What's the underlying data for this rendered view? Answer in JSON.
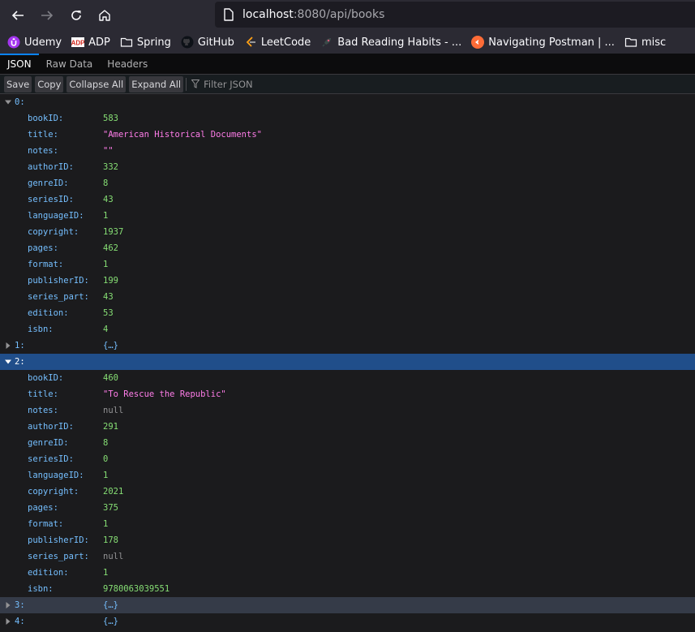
{
  "browser": {
    "url_host": "localhost",
    "url_rest": ":8080/api/books",
    "bookmarks": [
      {
        "label": "Udemy",
        "icon": "udemy-icon"
      },
      {
        "label": "ADP",
        "icon": "adp-icon"
      },
      {
        "label": "Spring",
        "icon": "folder-icon"
      },
      {
        "label": "GitHub",
        "icon": "github-icon"
      },
      {
        "label": "LeetCode",
        "icon": "leetcode-icon"
      },
      {
        "label": "Bad Reading Habits - ...",
        "icon": "rocket-icon"
      },
      {
        "label": "Navigating Postman | ...",
        "icon": "postman-icon"
      },
      {
        "label": "misc",
        "icon": "folder-icon"
      }
    ]
  },
  "viewer": {
    "tabs": [
      "JSON",
      "Raw Data",
      "Headers"
    ],
    "active_tab": "JSON",
    "toolbar": {
      "save": "Save",
      "copy": "Copy",
      "collapse_all": "Collapse All",
      "expand_all": "Expand All",
      "filter_placeholder": "Filter JSON"
    }
  },
  "tree": {
    "items": [
      {
        "index": "0:",
        "expanded": true,
        "fields": [
          {
            "key": "bookID:",
            "value": "583",
            "type": "num"
          },
          {
            "key": "title:",
            "value": "\"American Historical Documents\"",
            "type": "str"
          },
          {
            "key": "notes:",
            "value": "\"\"",
            "type": "str"
          },
          {
            "key": "authorID:",
            "value": "332",
            "type": "num"
          },
          {
            "key": "genreID:",
            "value": "8",
            "type": "num"
          },
          {
            "key": "seriesID:",
            "value": "43",
            "type": "num"
          },
          {
            "key": "languageID:",
            "value": "1",
            "type": "num"
          },
          {
            "key": "copyright:",
            "value": "1937",
            "type": "num"
          },
          {
            "key": "pages:",
            "value": "462",
            "type": "num"
          },
          {
            "key": "format:",
            "value": "1",
            "type": "num"
          },
          {
            "key": "publisherID:",
            "value": "199",
            "type": "num"
          },
          {
            "key": "series_part:",
            "value": "43",
            "type": "num"
          },
          {
            "key": "edition:",
            "value": "53",
            "type": "num"
          },
          {
            "key": "isbn:",
            "value": "4",
            "type": "num"
          }
        ]
      },
      {
        "index": "1:",
        "expanded": false,
        "collapsed_label": "{…}"
      },
      {
        "index": "2:",
        "expanded": true,
        "selected": true,
        "fields": [
          {
            "key": "bookID:",
            "value": "460",
            "type": "num"
          },
          {
            "key": "title:",
            "value": "\"To Rescue the Republic\"",
            "type": "str"
          },
          {
            "key": "notes:",
            "value": "null",
            "type": "null"
          },
          {
            "key": "authorID:",
            "value": "291",
            "type": "num"
          },
          {
            "key": "genreID:",
            "value": "8",
            "type": "num"
          },
          {
            "key": "seriesID:",
            "value": "0",
            "type": "num"
          },
          {
            "key": "languageID:",
            "value": "1",
            "type": "num"
          },
          {
            "key": "copyright:",
            "value": "2021",
            "type": "num"
          },
          {
            "key": "pages:",
            "value": "375",
            "type": "num"
          },
          {
            "key": "format:",
            "value": "1",
            "type": "num"
          },
          {
            "key": "publisherID:",
            "value": "178",
            "type": "num"
          },
          {
            "key": "series_part:",
            "value": "null",
            "type": "null"
          },
          {
            "key": "edition:",
            "value": "1",
            "type": "num"
          },
          {
            "key": "isbn:",
            "value": "9780063039551",
            "type": "num"
          }
        ]
      },
      {
        "index": "3:",
        "expanded": false,
        "hover": true,
        "collapsed_label": "{…}"
      },
      {
        "index": "4:",
        "expanded": false,
        "collapsed_label": "{…}"
      }
    ]
  }
}
